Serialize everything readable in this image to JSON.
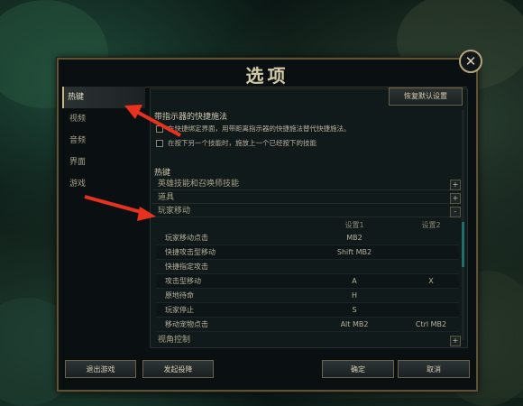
{
  "dialog": {
    "title": "选项",
    "reset_label": "恢复默认设置",
    "close_symbol": "✕"
  },
  "sidebar": {
    "items": [
      {
        "label": "热键",
        "active": true
      },
      {
        "label": "视频",
        "active": false
      },
      {
        "label": "音频",
        "active": false
      },
      {
        "label": "界面",
        "active": false
      },
      {
        "label": "游戏",
        "active": false
      }
    ]
  },
  "quickcast": {
    "title": "带指示器的快捷施法",
    "options": [
      {
        "label": "在快捷绑定界面，用带距离指示器的快捷施法替代快捷施法。",
        "checked": false
      },
      {
        "label": "在按下另一个技能时，施放上一个已经按下的技能",
        "checked": false
      }
    ]
  },
  "hotkeys": {
    "title": "热键",
    "categories": [
      {
        "label": "英雄技能和召唤师技能",
        "toggle": "+"
      },
      {
        "label": "道具",
        "toggle": "+"
      },
      {
        "label": "玩家移动",
        "toggle": "-"
      }
    ],
    "col1": "设置1",
    "col2": "设置2",
    "rows": [
      {
        "label": "玩家移动点击",
        "s1": "MB2",
        "s2": ""
      },
      {
        "label": "快捷攻击型移动",
        "s1": "Shift MB2",
        "s2": ""
      },
      {
        "label": "快捷指定攻击",
        "s1": "",
        "s2": ""
      },
      {
        "label": "攻击型移动",
        "s1": "A",
        "s2": "X"
      },
      {
        "label": "原地待命",
        "s1": "H",
        "s2": ""
      },
      {
        "label": "玩家停止",
        "s1": "S",
        "s2": ""
      },
      {
        "label": "移动宠物点击",
        "s1": "Alt MB2",
        "s2": "Ctrl MB2"
      }
    ],
    "camera": {
      "label": "视角控制",
      "toggle": "+"
    }
  },
  "footer": {
    "exit_label": "退出游戏",
    "surrender_label": "发起投降",
    "ok_label": "确定",
    "cancel_label": "取消"
  },
  "colors": {
    "frame_gold": "#5e5235",
    "accent_teal": "#1f6f6c",
    "arrow_red": "#e8321e"
  }
}
